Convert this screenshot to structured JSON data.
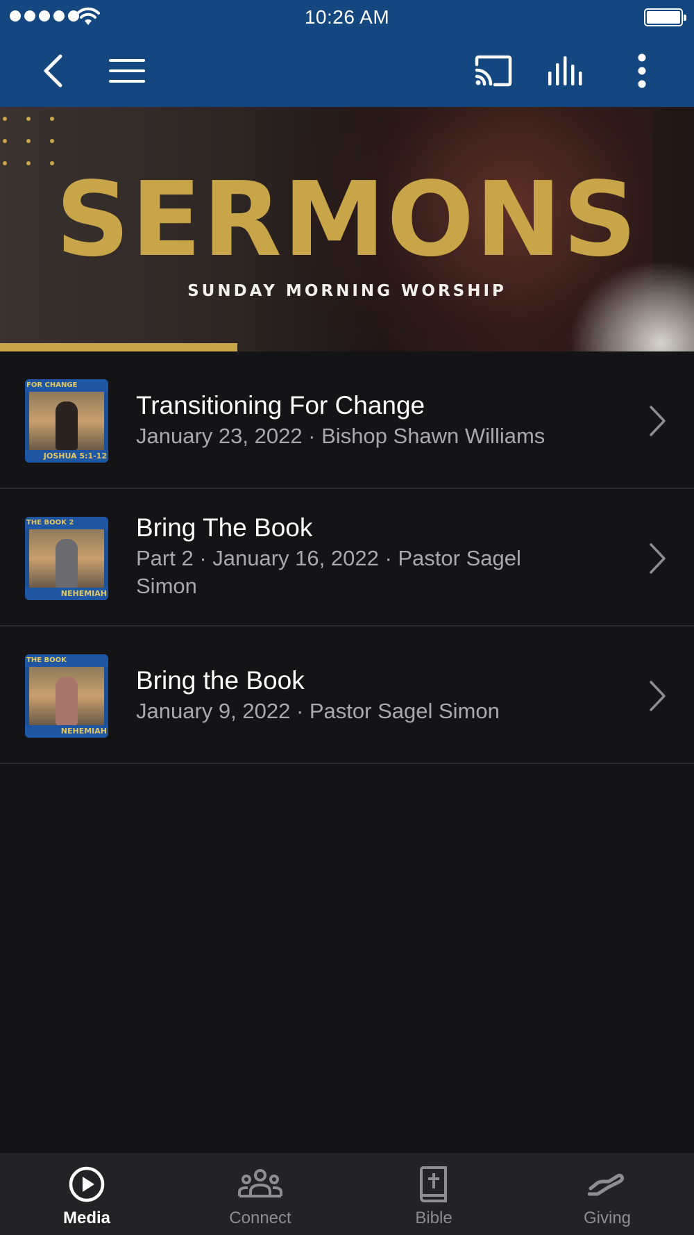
{
  "status_bar": {
    "time": "10:26 AM"
  },
  "nav": {
    "back_icon": "chevron-left-icon",
    "menu_icon": "hamburger-menu-icon",
    "cast_icon": "cast-icon",
    "audio_icon": "audio-bars-icon",
    "more_icon": "more-vertical-icon"
  },
  "banner": {
    "title": "SERMONS",
    "subtitle": "SUNDAY MORNING WORSHIP"
  },
  "sermons": [
    {
      "title": "Transitioning For Change",
      "subtitle": "January 23, 2022 · Bishop Shawn Williams",
      "thumb_top": "FOR CHANGE",
      "thumb_bottom": "JOSHUA 5:1-12"
    },
    {
      "title": "Bring The Book",
      "subtitle": "Part 2 · January 16, 2022 · Pastor Sagel Simon",
      "thumb_top": "THE BOOK 2",
      "thumb_bottom": "NEHEMIAH"
    },
    {
      "title": "Bring the Book",
      "subtitle": "January 9, 2022 · Pastor Sagel Simon",
      "thumb_top": "THE BOOK",
      "thumb_bottom": "NEHEMIAH"
    }
  ],
  "tabs": [
    {
      "label": "Media",
      "icon": "play-circle-icon",
      "active": true
    },
    {
      "label": "Connect",
      "icon": "group-icon",
      "active": false
    },
    {
      "label": "Bible",
      "icon": "bible-icon",
      "active": false
    },
    {
      "label": "Giving",
      "icon": "giving-hand-icon",
      "active": false
    }
  ],
  "colors": {
    "header": "#14467f",
    "background": "#141416",
    "gold": "#c9a54a",
    "tab_bar": "#232326"
  }
}
